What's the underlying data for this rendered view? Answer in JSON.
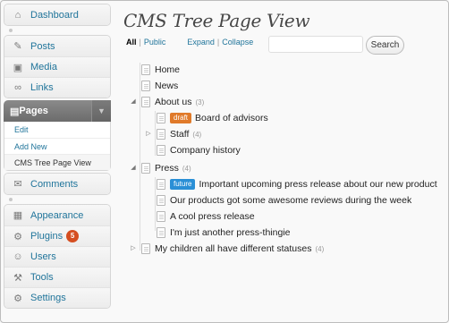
{
  "sidebar": {
    "dashboard": "Dashboard",
    "posts": "Posts",
    "media": "Media",
    "links": "Links",
    "pages": "Pages",
    "pages_sub": [
      "Edit",
      "Add New",
      "CMS Tree Page View"
    ],
    "comments": "Comments",
    "appearance": "Appearance",
    "plugins": "Plugins",
    "plugins_badge": "5",
    "users": "Users",
    "tools": "Tools",
    "settings": "Settings"
  },
  "main": {
    "title": "CMS Tree Page View",
    "filter_all": "All",
    "filter_public": "Public",
    "expand": "Expand",
    "collapse": "Collapse",
    "separator": "|",
    "search_value": "",
    "search_button": "Search"
  },
  "tree": [
    {
      "label": "Home"
    },
    {
      "label": "News"
    },
    {
      "label": "About us",
      "count": "(3)"
    },
    {
      "label": "Board of advisors",
      "status": "draft"
    },
    {
      "label": "Staff",
      "count": "(4)"
    },
    {
      "label": "Company history"
    },
    {
      "label": "Press",
      "count": "(4)"
    },
    {
      "label": "Important upcoming press release about our new product",
      "status": "future"
    },
    {
      "label": "Our products got some awesome reviews during the week"
    },
    {
      "label": "A cool press release"
    },
    {
      "label": "I'm just another press-thingie"
    },
    {
      "label": "My children all have different statuses",
      "count": "(4)"
    }
  ],
  "colors": {
    "link": "#21759b",
    "draft": "#e07a2a",
    "future": "#2a8fd6",
    "plugin_badge": "#d54e21"
  }
}
